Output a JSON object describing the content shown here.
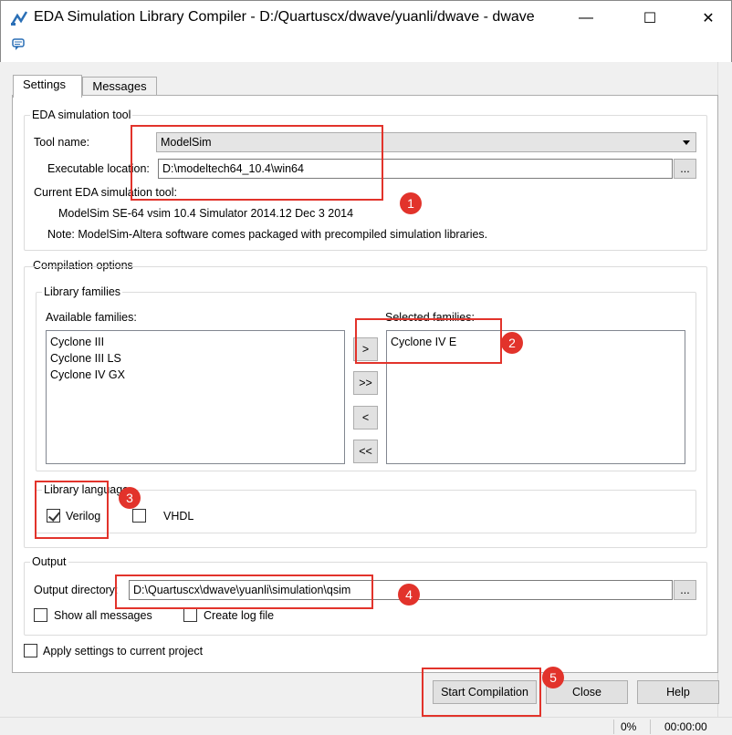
{
  "window": {
    "title": "EDA Simulation Library Compiler - D:/Quartuscx/dwave/yuanli/dwave - dwave",
    "minimize_glyph": "—",
    "maximize_glyph": "☐",
    "close_glyph": "✕"
  },
  "tabs": [
    {
      "label": "Settings",
      "active": true
    },
    {
      "label": "Messages",
      "active": false
    }
  ],
  "eda_tool": {
    "group_title": "EDA simulation tool",
    "tool_name_label": "Tool name:",
    "tool_name_value": "ModelSim",
    "exec_location_label": "Executable location:",
    "exec_location_value": "D:\\modeltech64_10.4\\win64",
    "browse_label": "...",
    "current_tool_label": "Current EDA simulation tool:",
    "current_tool_value": "ModelSim SE-64 vsim 10.4 Simulator 2014.12 Dec  3 2014",
    "note": "Note: ModelSim-Altera software comes packaged with precompiled simulation libraries."
  },
  "compilation": {
    "group_title": "Compilation options",
    "families_group_title": "Library families",
    "available_label": "Available families:",
    "available": [
      "Cyclone III",
      "Cyclone III LS",
      "Cyclone IV GX"
    ],
    "selected_label": "Selected families:",
    "selected": [
      "Cyclone IV E"
    ],
    "move_buttons": [
      ">",
      ">>",
      "<",
      "<<"
    ],
    "language_group_title": "Library language",
    "languages": [
      {
        "label": "Verilog",
        "checked": true
      },
      {
        "label": "VHDL",
        "checked": false
      }
    ]
  },
  "output": {
    "group_title": "Output",
    "dir_label": "Output directory:",
    "dir_value": "D:\\Quartuscx\\dwave\\yuanli\\simulation\\qsim",
    "browse_label": "...",
    "show_all_messages": {
      "label": "Show all messages",
      "checked": false
    },
    "create_log_file": {
      "label": "Create log file",
      "checked": false
    }
  },
  "apply_settings": {
    "label": "Apply settings to current project",
    "checked": false
  },
  "buttons": {
    "start": "Start Compilation",
    "close": "Close",
    "help": "Help"
  },
  "status": {
    "progress": "0%",
    "elapsed": "00:00:00"
  },
  "annotations": [
    "1",
    "2",
    "3",
    "4",
    "5"
  ],
  "colors": {
    "annotation": "#e2332b"
  }
}
